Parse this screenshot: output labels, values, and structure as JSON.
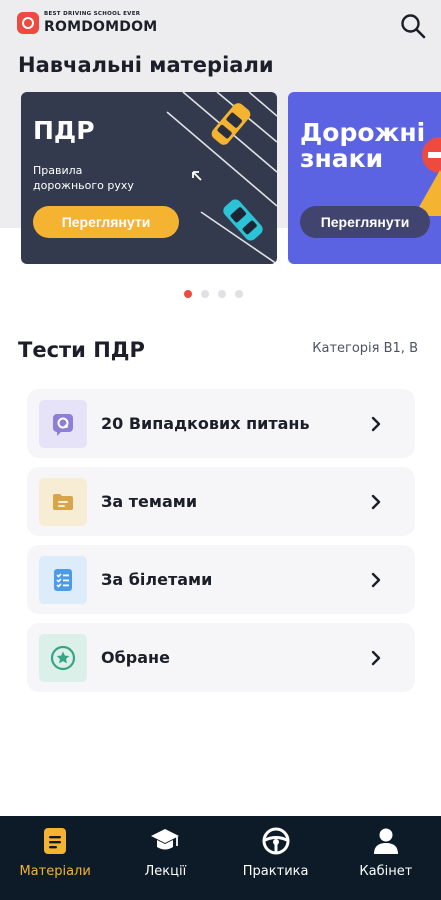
{
  "header": {
    "logo_tagline": "BEST DRIVING SCHOOL EVER",
    "logo_name": "ROMDOMDOM",
    "search_icon": "search-icon"
  },
  "materials": {
    "title": "Навчальні матеріали",
    "cards": [
      {
        "title": "ПДР",
        "subtitle": "Правила дорожнього руху",
        "button": "Переглянути",
        "color": "#343a4d",
        "button_color": "#f5b332"
      },
      {
        "title": "Дорожні знаки",
        "button": "Переглянути",
        "color": "#5c63e3",
        "button_color": "#40446e"
      }
    ],
    "carousel": {
      "count": 4,
      "active": 0
    }
  },
  "tests": {
    "title": "Тести ПДР",
    "category": "Категорія B1, B",
    "items": [
      {
        "label": "20 Випадкових питань",
        "icon": "question-bubble-icon",
        "icon_bg": "#e6e2f7",
        "icon_color": "#8d7ed8"
      },
      {
        "label": "За темами",
        "icon": "folder-icon",
        "icon_bg": "#f7ecd4",
        "icon_color": "#d7a64a"
      },
      {
        "label": "За білетами",
        "icon": "checklist-icon",
        "icon_bg": "#dcecfb",
        "icon_color": "#4d9be6"
      },
      {
        "label": "Обране",
        "icon": "star-icon",
        "icon_bg": "#dbf0e8",
        "icon_color": "#3aa383"
      }
    ]
  },
  "nav": {
    "items": [
      {
        "label": "Матеріали",
        "icon": "document-icon",
        "active": true
      },
      {
        "label": "Лекції",
        "icon": "graduation-cap-icon",
        "active": false
      },
      {
        "label": "Практика",
        "icon": "steering-wheel-icon",
        "active": false
      },
      {
        "label": "Кабінет",
        "icon": "user-icon",
        "active": false
      }
    ],
    "active_color": "#f5b332"
  },
  "colors": {
    "accent": "#ef4a3f",
    "nav_bg": "#0d1a27"
  }
}
